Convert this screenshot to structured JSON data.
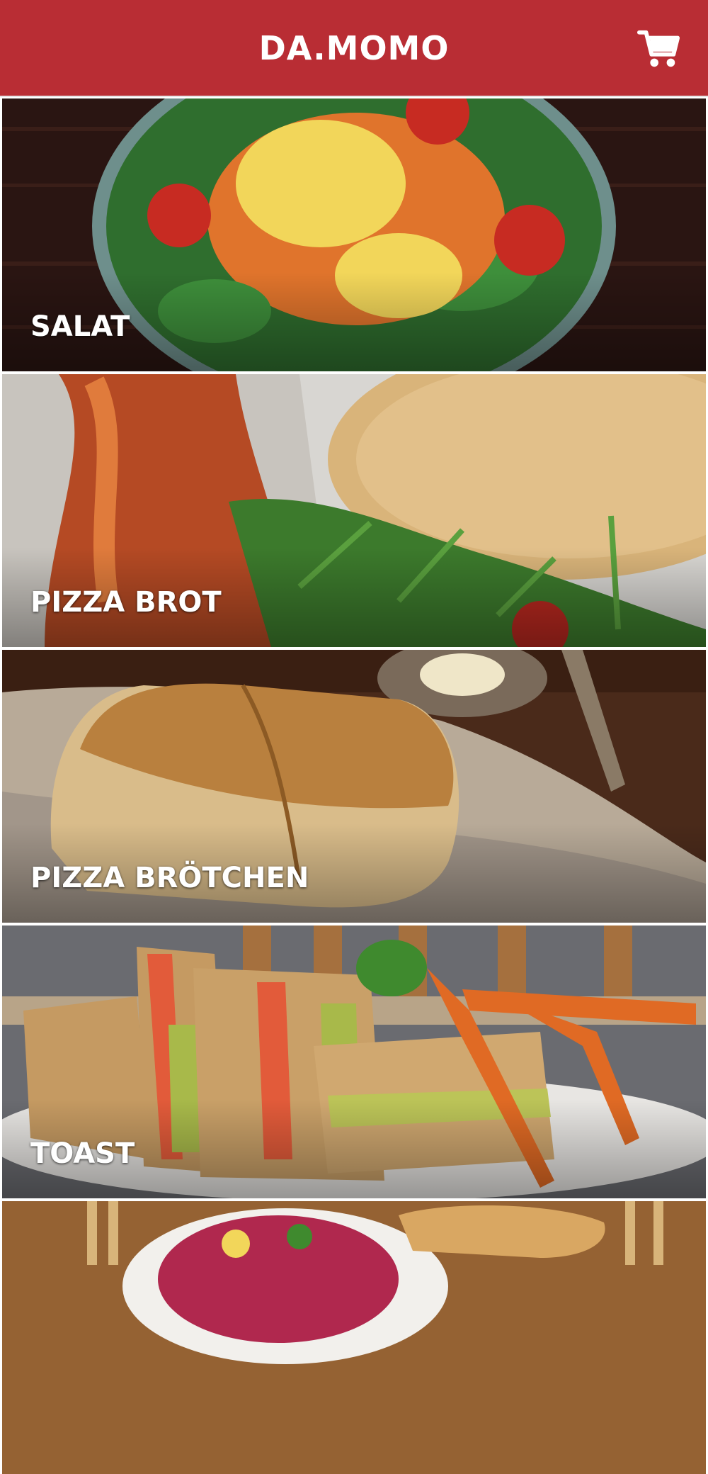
{
  "header": {
    "title": "DA.MOMO",
    "cart_icon": "shopping-cart-icon"
  },
  "categories": [
    {
      "label": "SALAT"
    },
    {
      "label": "PIZZA BROT"
    },
    {
      "label": "PIZZA BRÖTCHEN"
    },
    {
      "label": "TOAST"
    },
    {
      "label": ""
    }
  ],
  "colors": {
    "app_bar": "#b92d34",
    "title_text": "#ffffff"
  }
}
